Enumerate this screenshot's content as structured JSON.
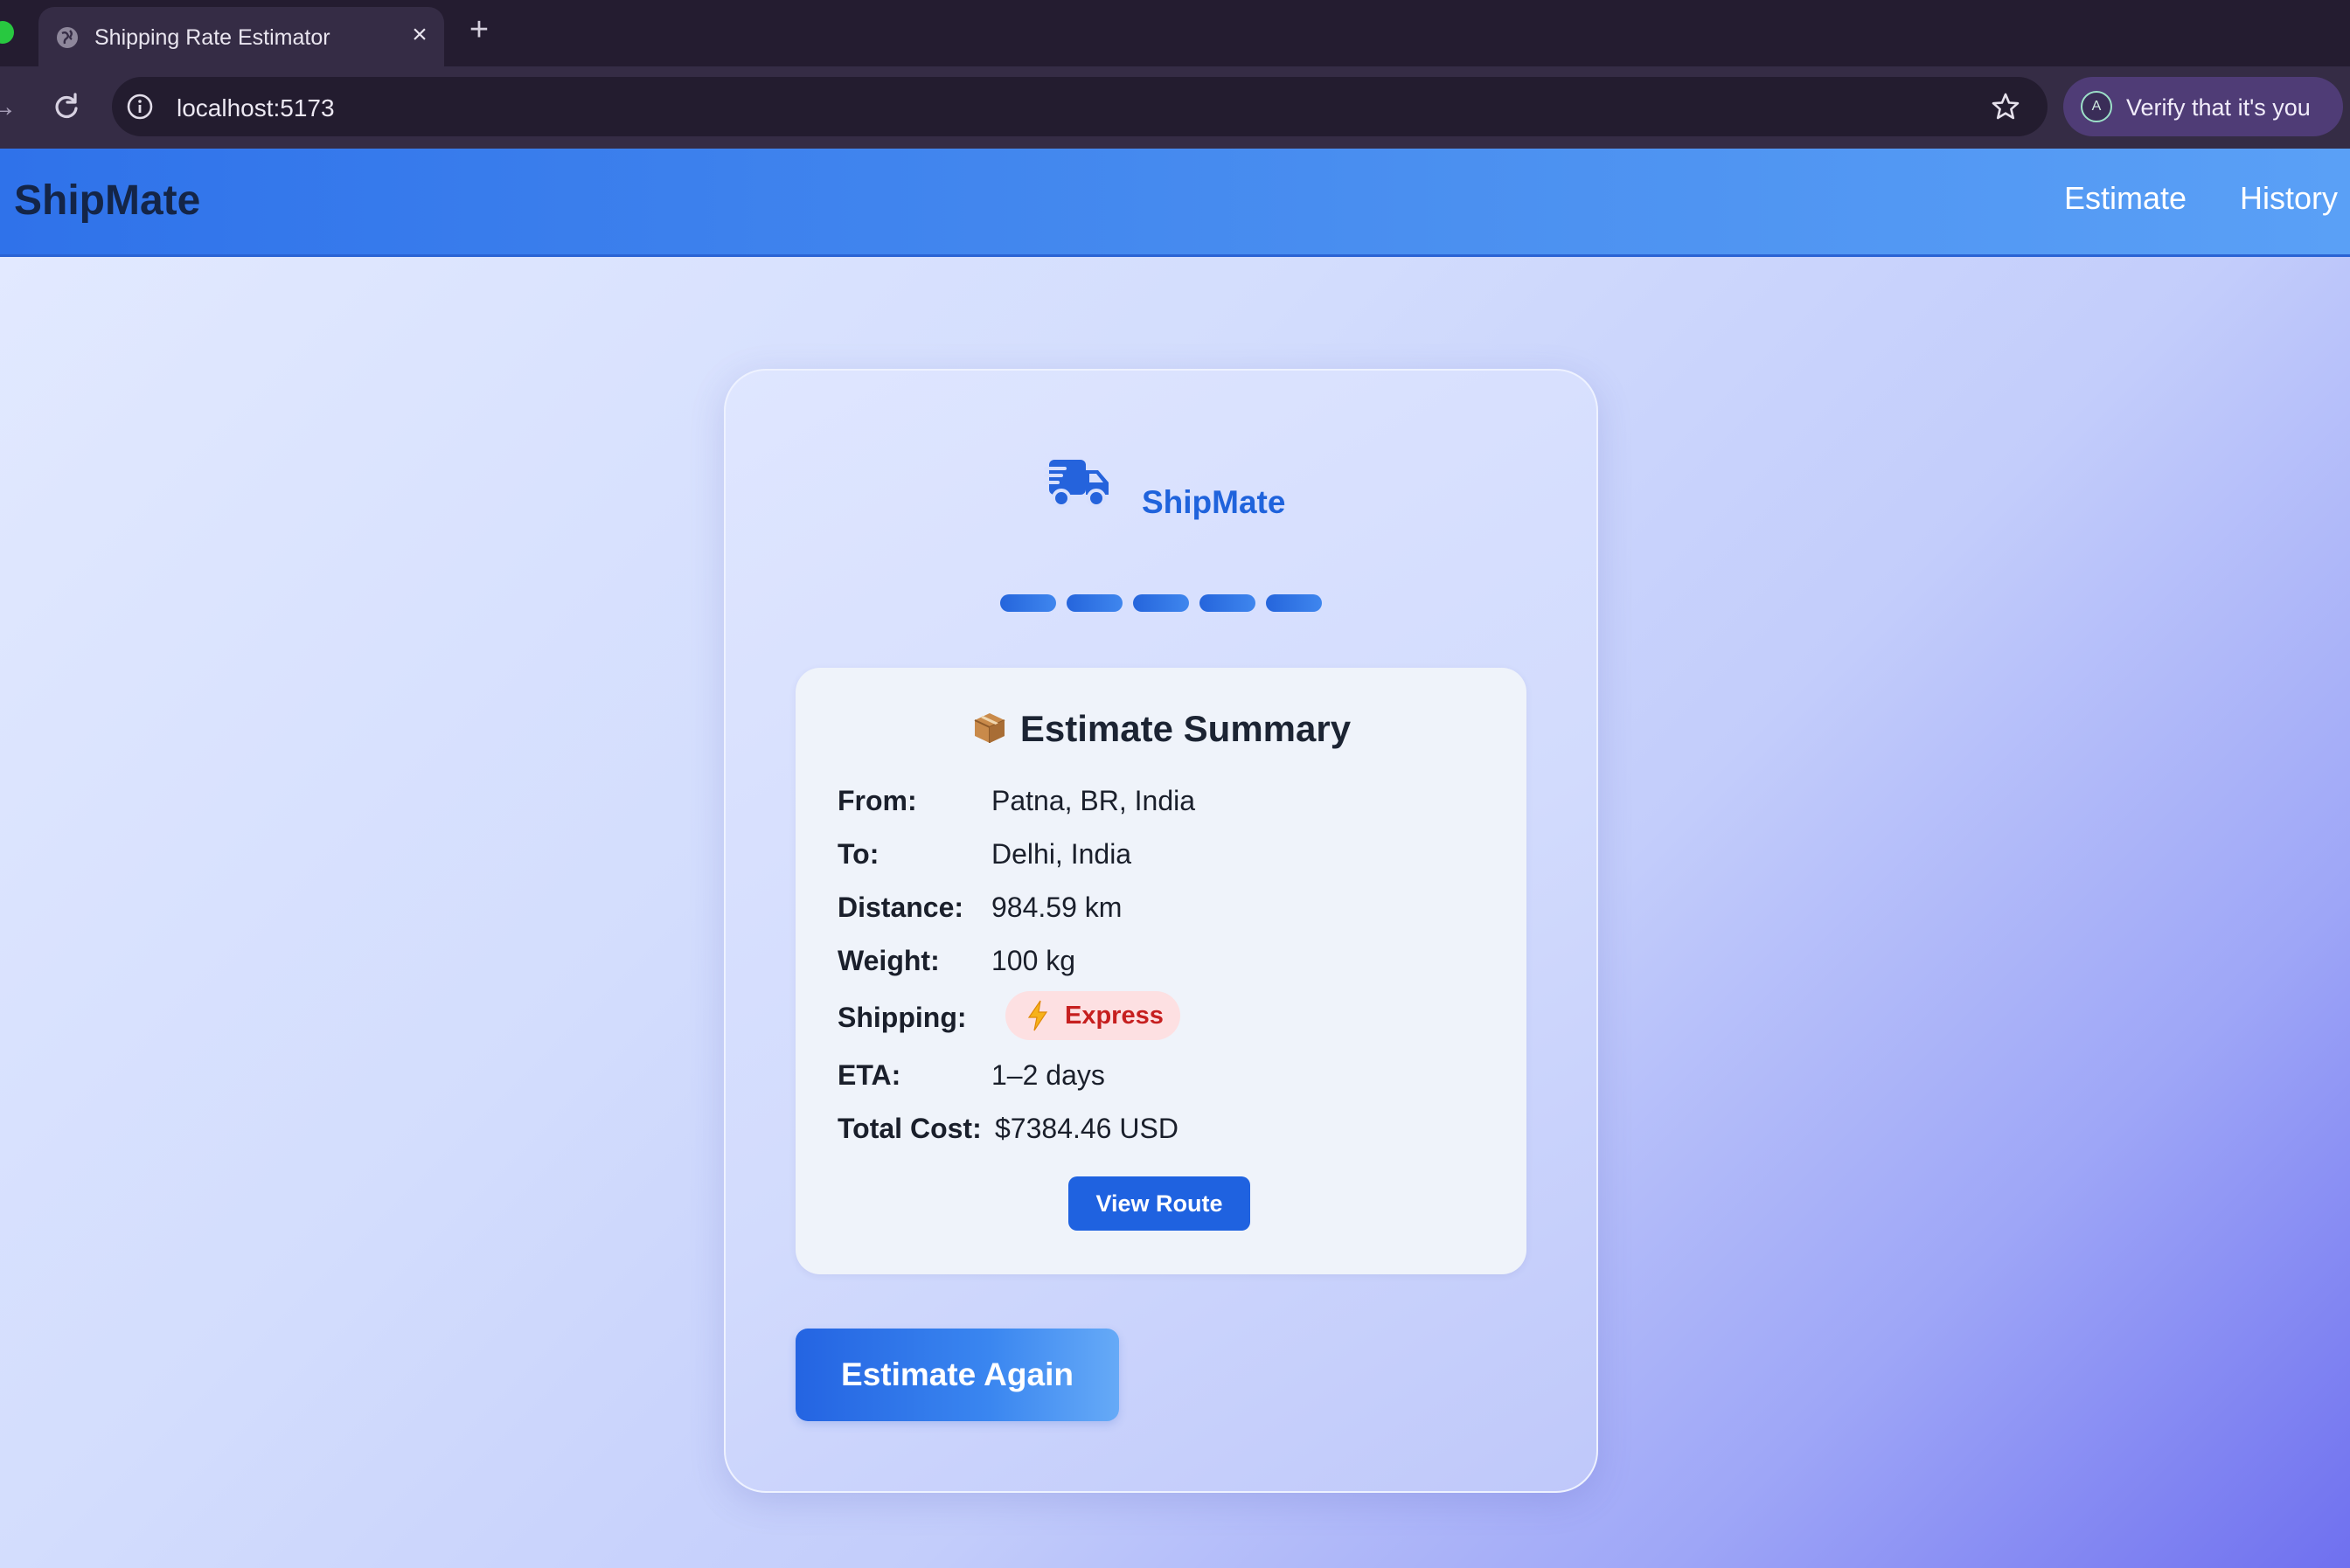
{
  "browser": {
    "tab_title": "Shipping Rate Estimator",
    "tab_close": "×",
    "new_tab": "+",
    "url": "localhost:5173",
    "profile_text": "Verify that it's you",
    "profile_initial": "A"
  },
  "nav": {
    "brand": "ShipMate",
    "links": [
      "Estimate",
      "History"
    ]
  },
  "card": {
    "brand": "ShipMate",
    "steps_total": 5,
    "steps_completed": 5
  },
  "summary": {
    "title": "Estimate Summary",
    "from_label": "From:",
    "from_value": "Patna, BR, India",
    "to_label": "To:",
    "to_value": "Delhi, India",
    "distance_label": "Distance:",
    "distance_value": "984.59 km",
    "weight_label": "Weight:",
    "weight_value": "100 kg",
    "shipping_label": "Shipping:",
    "shipping_value": "Express",
    "eta_label": "ETA:",
    "eta_value": "1–2 days",
    "total_label": "Total Cost:",
    "total_value": "$7384.46 USD",
    "view_route_label": "View Route"
  },
  "actions": {
    "estimate_again_label": "Estimate Again"
  },
  "icons": {
    "tab": "globe-icon",
    "info": "info-icon",
    "bookmark": "star-icon",
    "logo": "truck-icon",
    "summary": "package-icon",
    "shipping": "lightning-icon"
  },
  "colors": {
    "brand_blue": "#1f63dc",
    "express_badge_bg": "#fde0e2",
    "express_badge_text": "#c61f1f"
  }
}
